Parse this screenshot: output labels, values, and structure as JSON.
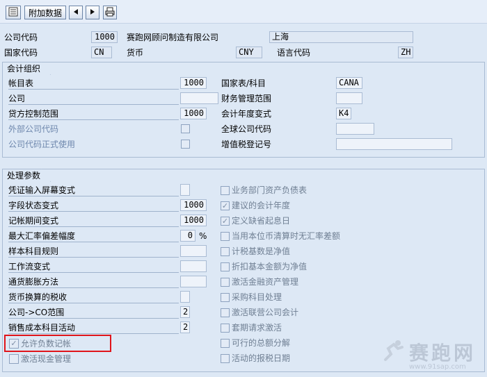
{
  "toolbar": {
    "attach_data_label": "附加数据"
  },
  "header": {
    "company_code_label": "公司代码",
    "company_code_value": "1000",
    "company_name": "赛跑网顾问制造有限公司",
    "city": "上海",
    "country_code_label": "国家代码",
    "country_code_value": "CN",
    "currency_label": "货币",
    "currency_value": "CNY",
    "language_label": "语言代码",
    "language_value": "ZH"
  },
  "account_org": {
    "title": "会计组织",
    "chart_of_accounts_label": "帐目表",
    "chart_of_accounts_value": "1000",
    "country_chart_label": "国家表/科目",
    "country_chart_value": "CANA",
    "company_label": "公司",
    "fm_area_label": "财务管理范围",
    "credit_control_label": "贷方控制范围",
    "credit_control_value": "1000",
    "fiscal_variant_label": "会计年度变式",
    "fiscal_variant_value": "K4",
    "external_code_label": "外部公司代码",
    "global_code_label": "全球公司代码",
    "productive_label": "公司代码正式使用",
    "vat_label": "增值税登记号"
  },
  "processing": {
    "title": "处理参数",
    "left": [
      {
        "label": "凭证输入屏幕变式",
        "value": ""
      },
      {
        "label": "字段状态变式",
        "value": "1000"
      },
      {
        "label": "记帐期间变式",
        "value": "1000"
      },
      {
        "label": "最大汇率偏差幅度",
        "value": "0",
        "unit": "%"
      },
      {
        "label": "样本科目规则",
        "value": ""
      },
      {
        "label": "工作流变式",
        "value": ""
      },
      {
        "label": "通货膨胀方法",
        "value": ""
      },
      {
        "label": "货币换算的税收",
        "value": ""
      },
      {
        "label": "公司->CO范围",
        "value": "2"
      },
      {
        "label": "销售成本科目活动",
        "value": "2"
      }
    ],
    "neg_posting_label": "允许负数记帐",
    "cash_mgmt_label": "激活现金管理",
    "right": [
      {
        "label": "业务部门资产负债表",
        "checked": false
      },
      {
        "label": "建议的会计年度",
        "checked": true
      },
      {
        "label": "定义缺省起息日",
        "checked": true
      },
      {
        "label": "当用本位币清算时无汇率差额",
        "checked": false
      },
      {
        "label": "计税基数是净值",
        "checked": false
      },
      {
        "label": "折扣基本金额为净值",
        "checked": false
      },
      {
        "label": "激活金融资产管理",
        "checked": false
      },
      {
        "label": "采购科目处理",
        "checked": false
      },
      {
        "label": "激活联营公司会计",
        "checked": false
      },
      {
        "label": "套期请求激活",
        "checked": false
      },
      {
        "label": "可行的总额分解",
        "checked": false
      },
      {
        "label": "活动的报税日期",
        "checked": false
      }
    ]
  },
  "watermark": {
    "brand": "赛跑网",
    "url": "www.91sap.com"
  }
}
